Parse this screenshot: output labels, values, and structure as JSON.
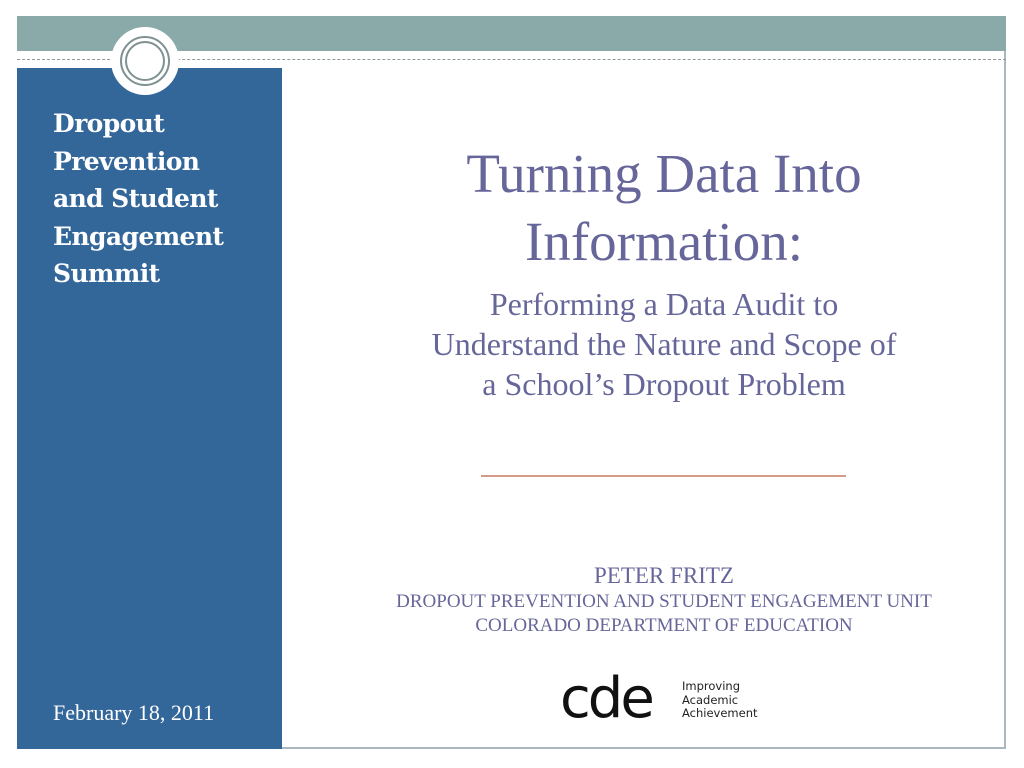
{
  "sidebar": {
    "title_lines": [
      "Dropout",
      "Prevention",
      "and Student",
      "Engagement",
      "Summit"
    ],
    "date": "February 18, 2011",
    "color": "#336699"
  },
  "header": {
    "band_color": "#8aaaa9",
    "emblem": "circle-emblem-icon"
  },
  "main": {
    "title_lines": [
      "Turning Data Into",
      "Information:"
    ],
    "subtitle_lines": [
      "Performing a Data Audit to",
      "Understand the Nature and Scope of",
      "a School’s Dropout Problem"
    ],
    "text_color": "#66669a",
    "divider_color": "#d49a85"
  },
  "presenter": {
    "name": "PETER FRITZ",
    "unit": "DROPOUT PREVENTION AND STUDENT ENGAGEMENT UNIT",
    "department": "COLORADO DEPARTMENT OF EDUCATION"
  },
  "logo": {
    "wordmark": "cde",
    "tagline_lines": [
      "Improving",
      "Academic",
      "Achievement"
    ]
  }
}
